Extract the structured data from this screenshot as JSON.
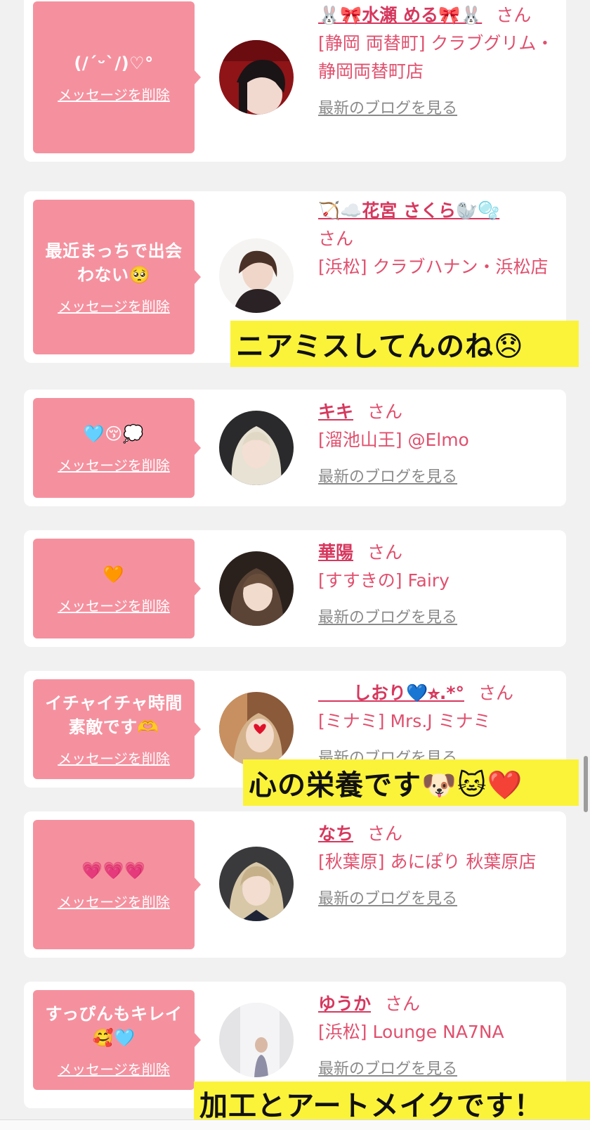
{
  "delete_label": "メッセージを削除",
  "blog_label": "最新のブログを見る",
  "san_label": "さん",
  "cards": [
    {
      "message": "(/ˊᵕˋ/)♡°",
      "name": "🐰🎀水瀬 める🎀🐰",
      "shop": "[静岡 両替町] クラブグリム・静岡両替町店",
      "blog_visible": true
    },
    {
      "message": "最近まっちで出会わない🥺",
      "name": "🏹☁️花宮 さくら🦭🫧",
      "shop": "[浜松] クラブハナン・浜松店",
      "blog_visible": false
    },
    {
      "message": "🩵😚💭",
      "name": "キキ",
      "shop": "[溜池山王] @Elmo",
      "blog_visible": true
    },
    {
      "message": "🧡",
      "name": "華陽",
      "shop": "[すすきの] Fairy",
      "blog_visible": true
    },
    {
      "message": "イチャイチャ時間素敵です🫶",
      "name": "　　しおり💙⭐︎.*°",
      "shop": "[ミナミ] Mrs.J ミナミ",
      "blog_visible": true
    },
    {
      "message": "💗💗💗",
      "name": "なち",
      "shop": "[秋葉原] あにぽり 秋葉原店",
      "blog_visible": true
    },
    {
      "message": "すっぴんもキレイ🥰🩵",
      "name": "ゆうか",
      "shop": "[浜松] Lounge NA7NA",
      "blog_visible": true
    }
  ],
  "captions": {
    "caption_1": "ニアミスしてんのね😞",
    "caption_2": "心の栄養です🐶🐱❤️",
    "caption_3": "加工とアートメイクです！"
  },
  "colors": {
    "bubble_bg": "#f5919f",
    "name_pink": "#d6385e",
    "caption_bg": "#fbf33a",
    "page_bg": "#f1f1f1"
  }
}
